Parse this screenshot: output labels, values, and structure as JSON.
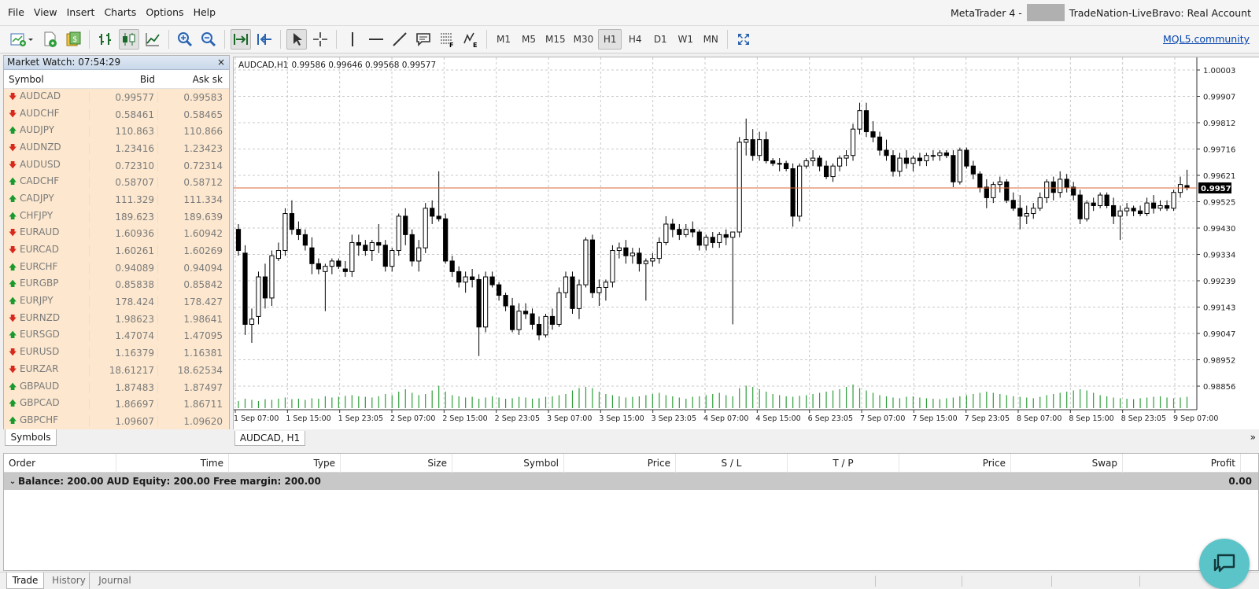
{
  "menu": [
    "File",
    "View",
    "Insert",
    "Charts",
    "Options",
    "Help"
  ],
  "title": {
    "app": "MetaTrader 4 -",
    "account": "TradeNation-LiveBravo: Real Account"
  },
  "toolbar": {
    "timeframes": [
      "M1",
      "M5",
      "M15",
      "M30",
      "H1",
      "H4",
      "D1",
      "W1",
      "MN"
    ],
    "active_timeframe": "H1",
    "mql_link": "MQL5.community"
  },
  "market_watch": {
    "title": "Market Watch: 07:54:29",
    "close": "×",
    "headers": {
      "symbol": "Symbol",
      "bid": "Bid",
      "ask": "Ask sk"
    },
    "rows": [
      {
        "symbol": "AUDCAD",
        "bid": "0.99577",
        "ask": "0.99583",
        "dir": "down"
      },
      {
        "symbol": "AUDCHF",
        "bid": "0.58461",
        "ask": "0.58465",
        "dir": "down"
      },
      {
        "symbol": "AUDJPY",
        "bid": "110.863",
        "ask": "110.866",
        "dir": "up"
      },
      {
        "symbol": "AUDNZD",
        "bid": "1.23416",
        "ask": "1.23423",
        "dir": "down"
      },
      {
        "symbol": "AUDUSD",
        "bid": "0.72310",
        "ask": "0.72314",
        "dir": "down"
      },
      {
        "symbol": "CADCHF",
        "bid": "0.58707",
        "ask": "0.58712",
        "dir": "up"
      },
      {
        "symbol": "CADJPY",
        "bid": "111.329",
        "ask": "111.334",
        "dir": "up"
      },
      {
        "symbol": "CHFJPY",
        "bid": "189.623",
        "ask": "189.639",
        "dir": "up"
      },
      {
        "symbol": "EURAUD",
        "bid": "1.60936",
        "ask": "1.60942",
        "dir": "down"
      },
      {
        "symbol": "EURCAD",
        "bid": "1.60261",
        "ask": "1.60269",
        "dir": "down"
      },
      {
        "symbol": "EURCHF",
        "bid": "0.94089",
        "ask": "0.94094",
        "dir": "up"
      },
      {
        "symbol": "EURGBP",
        "bid": "0.85838",
        "ask": "0.85842",
        "dir": "up"
      },
      {
        "symbol": "EURJPY",
        "bid": "178.424",
        "ask": "178.427",
        "dir": "up"
      },
      {
        "symbol": "EURNZD",
        "bid": "1.98623",
        "ask": "1.98641",
        "dir": "down"
      },
      {
        "symbol": "EURSGD",
        "bid": "1.47074",
        "ask": "1.47095",
        "dir": "up"
      },
      {
        "symbol": "EURUSD",
        "bid": "1.16379",
        "ask": "1.16381",
        "dir": "down"
      },
      {
        "symbol": "EURZAR",
        "bid": "18.61217",
        "ask": "18.62534",
        "dir": "down"
      },
      {
        "symbol": "GBPAUD",
        "bid": "1.87483",
        "ask": "1.87497",
        "dir": "up"
      },
      {
        "symbol": "GBPCAD",
        "bid": "1.86697",
        "ask": "1.86711",
        "dir": "up"
      },
      {
        "symbol": "GBPCHF",
        "bid": "1.09607",
        "ask": "1.09620",
        "dir": "up"
      }
    ],
    "tab": "Symbols"
  },
  "chart": {
    "symbol_tf": "AUDCAD,H1",
    "ohlc": "0.99586 0.99646 0.99568 0.99577",
    "tab": "AUDCAD, H1",
    "more": "»",
    "current_price": "0.99577",
    "price_labels": [
      "1.00003",
      "0.99907",
      "0.99812",
      "0.99716",
      "0.99621",
      "0.99525",
      "0.99430",
      "0.99334",
      "0.99239",
      "0.99143",
      "0.99047",
      "0.98952",
      "0.98856"
    ],
    "time_labels": [
      "1 Sep 07:00",
      "1 Sep 15:00",
      "1 Sep 23:05",
      "2 Sep 07:00",
      "2 Sep 15:00",
      "2 Sep 23:05",
      "3 Sep 07:00",
      "3 Sep 15:00",
      "3 Sep 23:05",
      "4 Sep 07:00",
      "4 Sep 15:00",
      "6 Sep 23:05",
      "7 Sep 07:00",
      "7 Sep 15:00",
      "7 Sep 23:05",
      "8 Sep 07:00",
      "8 Sep 15:00",
      "8 Sep 23:05",
      "9 Sep 07:00"
    ]
  },
  "chart_data": {
    "type": "candlestick",
    "title": "AUDCAD,H1",
    "ylim": [
      0.9882,
      1.0003
    ],
    "current_price": 0.99577,
    "candles": [
      [
        0.9942,
        0.9944,
        0.9932,
        0.9934
      ],
      [
        0.9933,
        0.9936,
        0.9902,
        0.9906
      ],
      [
        0.9906,
        0.9912,
        0.9899,
        0.9908
      ],
      [
        0.9909,
        0.9926,
        0.9906,
        0.9924
      ],
      [
        0.9924,
        0.9929,
        0.9912,
        0.9916
      ],
      [
        0.9916,
        0.9934,
        0.9913,
        0.9932
      ],
      [
        0.9931,
        0.9937,
        0.993,
        0.9934
      ],
      [
        0.9934,
        0.995,
        0.9932,
        0.9948
      ],
      [
        0.9948,
        0.9953,
        0.994,
        0.9942
      ],
      [
        0.9942,
        0.9945,
        0.9938,
        0.994
      ],
      [
        0.994,
        0.9942,
        0.9934,
        0.9936
      ],
      [
        0.9935,
        0.9939,
        0.9925,
        0.9929
      ],
      [
        0.9929,
        0.9931,
        0.9925,
        0.9927
      ],
      [
        0.9926,
        0.9929,
        0.9911,
        0.9928
      ],
      [
        0.9928,
        0.9931,
        0.9925,
        0.993
      ],
      [
        0.993,
        0.9931,
        0.9927,
        0.9928
      ],
      [
        0.9927,
        0.993,
        0.9924,
        0.9926
      ],
      [
        0.9926,
        0.994,
        0.9924,
        0.9937
      ],
      [
        0.9937,
        0.994,
        0.9932,
        0.9936
      ],
      [
        0.9936,
        0.9938,
        0.9932,
        0.9934
      ],
      [
        0.9934,
        0.9938,
        0.993,
        0.9937
      ],
      [
        0.9937,
        0.9944,
        0.9933,
        0.9936
      ],
      [
        0.9936,
        0.9938,
        0.9926,
        0.9928
      ],
      [
        0.9928,
        0.9935,
        0.9926,
        0.9934
      ],
      [
        0.9934,
        0.9948,
        0.9932,
        0.9947
      ],
      [
        0.9947,
        0.995,
        0.9936,
        0.994
      ],
      [
        0.994,
        0.9942,
        0.9928,
        0.993
      ],
      [
        0.993,
        0.9938,
        0.9926,
        0.9935
      ],
      [
        0.9935,
        0.9952,
        0.9933,
        0.995
      ],
      [
        0.995,
        0.9953,
        0.9944,
        0.9947
      ],
      [
        0.9947,
        0.9964,
        0.9945,
        0.9946
      ],
      [
        0.9946,
        0.9948,
        0.9929,
        0.993
      ],
      [
        0.993,
        0.9932,
        0.9924,
        0.9926
      ],
      [
        0.9926,
        0.9928,
        0.992,
        0.9922
      ],
      [
        0.9922,
        0.9926,
        0.9918,
        0.9924
      ],
      [
        0.9924,
        0.9927,
        0.992,
        0.9923
      ],
      [
        0.9923,
        0.9925,
        0.9894,
        0.9905
      ],
      [
        0.9905,
        0.9926,
        0.9903,
        0.9924
      ],
      [
        0.9924,
        0.9926,
        0.992,
        0.9921
      ],
      [
        0.9921,
        0.9922,
        0.9915,
        0.9917
      ],
      [
        0.9917,
        0.9918,
        0.9911,
        0.9913
      ],
      [
        0.9913,
        0.9916,
        0.9903,
        0.9904
      ],
      [
        0.9904,
        0.9914,
        0.9902,
        0.9911
      ],
      [
        0.9911,
        0.9914,
        0.9908,
        0.991
      ],
      [
        0.991,
        0.9912,
        0.9904,
        0.9906
      ],
      [
        0.9906,
        0.9909,
        0.99,
        0.9902
      ],
      [
        0.9902,
        0.991,
        0.9901,
        0.9909
      ],
      [
        0.9909,
        0.9912,
        0.9904,
        0.9906
      ],
      [
        0.9906,
        0.992,
        0.9905,
        0.9918
      ],
      [
        0.9918,
        0.9926,
        0.9916,
        0.9924
      ],
      [
        0.9924,
        0.9926,
        0.991,
        0.9912
      ],
      [
        0.9912,
        0.9923,
        0.9908,
        0.9921
      ],
      [
        0.9921,
        0.9939,
        0.992,
        0.9938
      ],
      [
        0.9938,
        0.994,
        0.9916,
        0.9918
      ],
      [
        0.9918,
        0.9923,
        0.9913,
        0.992
      ],
      [
        0.992,
        0.9923,
        0.9915,
        0.9922
      ],
      [
        0.9922,
        0.9936,
        0.992,
        0.9934
      ],
      [
        0.9934,
        0.9937,
        0.9931,
        0.9935
      ],
      [
        0.9935,
        0.9938,
        0.9929,
        0.9932
      ],
      [
        0.9932,
        0.9935,
        0.9929,
        0.9933
      ],
      [
        0.9933,
        0.9935,
        0.9926,
        0.9929
      ],
      [
        0.9929,
        0.9931,
        0.9915,
        0.993
      ],
      [
        0.993,
        0.9933,
        0.9928,
        0.9931
      ],
      [
        0.9931,
        0.9939,
        0.9929,
        0.9937
      ],
      [
        0.9937,
        0.9947,
        0.9936,
        0.9944
      ],
      [
        0.9944,
        0.9946,
        0.9939,
        0.9942
      ],
      [
        0.9942,
        0.9944,
        0.9938,
        0.994
      ],
      [
        0.994,
        0.9944,
        0.9939,
        0.9942
      ],
      [
        0.9942,
        0.9945,
        0.9939,
        0.9941
      ],
      [
        0.9941,
        0.9942,
        0.9934,
        0.9936
      ],
      [
        0.9936,
        0.994,
        0.9934,
        0.9939
      ],
      [
        0.9939,
        0.9941,
        0.9935,
        0.9937
      ],
      [
        0.9937,
        0.9941,
        0.9935,
        0.994
      ],
      [
        0.994,
        0.9942,
        0.9936,
        0.9939
      ],
      [
        0.9939,
        0.994,
        0.9906,
        0.9941
      ],
      [
        0.9941,
        0.9977,
        0.9939,
        0.9975
      ],
      [
        0.9975,
        0.9984,
        0.997,
        0.9976
      ],
      [
        0.9976,
        0.998,
        0.9968,
        0.997
      ],
      [
        0.997,
        0.9979,
        0.9968,
        0.9976
      ],
      [
        0.9976,
        0.9979,
        0.9967,
        0.9968
      ],
      [
        0.9968,
        0.9969,
        0.9966,
        0.9967
      ],
      [
        0.9967,
        0.9969,
        0.9964,
        0.9967
      ],
      [
        0.9967,
        0.9968,
        0.9964,
        0.9965
      ],
      [
        0.9965,
        0.9967,
        0.9943,
        0.9947
      ],
      [
        0.9947,
        0.9967,
        0.9945,
        0.9966
      ],
      [
        0.9966,
        0.9969,
        0.9965,
        0.9968
      ],
      [
        0.9968,
        0.9972,
        0.9966,
        0.9969
      ],
      [
        0.9969,
        0.997,
        0.9964,
        0.9966
      ],
      [
        0.9966,
        0.9968,
        0.9961,
        0.9962
      ],
      [
        0.9962,
        0.9967,
        0.996,
        0.9966
      ],
      [
        0.9966,
        0.997,
        0.9964,
        0.9969
      ],
      [
        0.9969,
        0.9972,
        0.9966,
        0.997
      ],
      [
        0.997,
        0.9982,
        0.9968,
        0.998
      ],
      [
        0.998,
        0.999,
        0.9978,
        0.9987
      ],
      [
        0.9987,
        0.999,
        0.9977,
        0.9979
      ],
      [
        0.9979,
        0.9983,
        0.9975,
        0.9977
      ],
      [
        0.9977,
        0.9979,
        0.997,
        0.9972
      ],
      [
        0.9972,
        0.9976,
        0.9968,
        0.997
      ],
      [
        0.997,
        0.9972,
        0.9962,
        0.9964
      ],
      [
        0.9964,
        0.9971,
        0.9962,
        0.9969
      ],
      [
        0.9969,
        0.9972,
        0.9965,
        0.9967
      ],
      [
        0.9967,
        0.997,
        0.9964,
        0.9969
      ],
      [
        0.9969,
        0.9971,
        0.9966,
        0.9968
      ],
      [
        0.9968,
        0.9971,
        0.9966,
        0.997
      ],
      [
        0.997,
        0.9972,
        0.9968,
        0.997
      ],
      [
        0.997,
        0.9972,
        0.9968,
        0.9971
      ],
      [
        0.9971,
        0.9972,
        0.9969,
        0.997
      ],
      [
        0.997,
        0.9972,
        0.9958,
        0.996
      ],
      [
        0.996,
        0.9973,
        0.9959,
        0.9972
      ],
      [
        0.9972,
        0.9973,
        0.9965,
        0.9966
      ],
      [
        0.9966,
        0.9968,
        0.9961,
        0.9963
      ],
      [
        0.9963,
        0.9964,
        0.9956,
        0.9958
      ],
      [
        0.9958,
        0.9961,
        0.995,
        0.9954
      ],
      [
        0.9954,
        0.996,
        0.9952,
        0.9959
      ],
      [
        0.9959,
        0.9962,
        0.9956,
        0.996
      ],
      [
        0.996,
        0.9961,
        0.9952,
        0.9953
      ],
      [
        0.9953,
        0.9956,
        0.9949,
        0.995
      ],
      [
        0.995,
        0.9955,
        0.9942,
        0.9947
      ],
      [
        0.9947,
        0.9951,
        0.9944,
        0.9948
      ],
      [
        0.9948,
        0.9952,
        0.9946,
        0.995
      ],
      [
        0.995,
        0.9956,
        0.9949,
        0.9954
      ],
      [
        0.9954,
        0.9961,
        0.9952,
        0.996
      ],
      [
        0.996,
        0.9962,
        0.9953,
        0.9956
      ],
      [
        0.9956,
        0.9964,
        0.9954,
        0.9961
      ],
      [
        0.9961,
        0.9963,
        0.9956,
        0.9958
      ],
      [
        0.9958,
        0.996,
        0.9953,
        0.9955
      ],
      [
        0.9955,
        0.9957,
        0.9944,
        0.9946
      ],
      [
        0.9946,
        0.9953,
        0.9945,
        0.9952
      ],
      [
        0.9952,
        0.9954,
        0.9949,
        0.9951
      ],
      [
        0.9951,
        0.9956,
        0.995,
        0.9955
      ],
      [
        0.9955,
        0.9956,
        0.995,
        0.9951
      ],
      [
        0.9951,
        0.9954,
        0.9944,
        0.9947
      ],
      [
        0.9947,
        0.9951,
        0.9938,
        0.9949
      ],
      [
        0.9949,
        0.9952,
        0.9947,
        0.995
      ],
      [
        0.995,
        0.9951,
        0.9947,
        0.9949
      ],
      [
        0.9949,
        0.9951,
        0.9947,
        0.9948
      ],
      [
        0.9948,
        0.9954,
        0.9947,
        0.9952
      ],
      [
        0.9952,
        0.9955,
        0.9948,
        0.995
      ],
      [
        0.995,
        0.9953,
        0.9949,
        0.9951
      ],
      [
        0.9951,
        0.9953,
        0.9949,
        0.995
      ],
      [
        0.995,
        0.9957,
        0.9949,
        0.9956
      ],
      [
        0.9956,
        0.9962,
        0.9954,
        0.9959
      ],
      [
        0.99586,
        0.99646,
        0.99568,
        0.99577
      ]
    ],
    "volumes": [
      0.3,
      0.4,
      0.35,
      0.3,
      0.38,
      0.35,
      0.4,
      0.45,
      0.38,
      0.4,
      0.35,
      0.42,
      0.4,
      0.5,
      0.45,
      0.48,
      0.52,
      0.55,
      0.5,
      0.48,
      0.45,
      0.5,
      0.6,
      0.55,
      0.7,
      0.8,
      0.65,
      0.55,
      0.6,
      0.75,
      0.95,
      0.7,
      0.55,
      0.5,
      0.45,
      0.48,
      0.4,
      0.45,
      0.5,
      0.45,
      0.4,
      0.42,
      0.48,
      0.45,
      0.4,
      0.42,
      0.48,
      0.5,
      0.55,
      0.6,
      0.75,
      0.85,
      0.9,
      0.85,
      0.7,
      0.6,
      0.55,
      0.5,
      0.45,
      0.48,
      0.5,
      0.55,
      0.6,
      0.65,
      0.55,
      0.5,
      0.45,
      0.4,
      0.48,
      0.5,
      0.55,
      0.6,
      0.65,
      0.55,
      0.5,
      0.85,
      0.95,
      0.9,
      0.8,
      0.7,
      0.6,
      0.55,
      0.5,
      0.48,
      0.52,
      0.55,
      0.6,
      0.65,
      0.7,
      0.75,
      0.8,
      0.9,
      1.0,
      0.85,
      0.75,
      0.65,
      0.55,
      0.5,
      0.45,
      0.42,
      0.48,
      0.5,
      0.45,
      0.42,
      0.4,
      0.38,
      0.42,
      0.45,
      0.5,
      0.55,
      0.6,
      0.65,
      0.7,
      0.65,
      0.6,
      0.55,
      0.5,
      0.48,
      0.45,
      0.42,
      0.48,
      0.55,
      0.6,
      0.65,
      0.7,
      0.75,
      0.8,
      0.75,
      0.65,
      0.55,
      0.5,
      0.45,
      0.42,
      0.4,
      0.38,
      0.42,
      0.45,
      0.48,
      0.5,
      0.45,
      0.42,
      0.45,
      0.48
    ]
  },
  "terminal": {
    "headers": [
      "Order",
      "Time",
      "Type",
      "Size",
      "Symbol",
      "Price",
      "S / L",
      "T / P",
      "Price",
      "Swap",
      "Profit"
    ],
    "balance": "Balance: 200.00 AUD  Equity: 200.00  Free margin: 200.00",
    "profit": "0.00",
    "tabs": [
      "Trade",
      "History",
      "Journal"
    ],
    "active_tab": "Trade"
  },
  "colors": {
    "bull": "#ffffff",
    "bear": "#000000",
    "volume": "#2e9e3a",
    "price_line": "#d86a3a",
    "grid": "#c8c8c8"
  }
}
